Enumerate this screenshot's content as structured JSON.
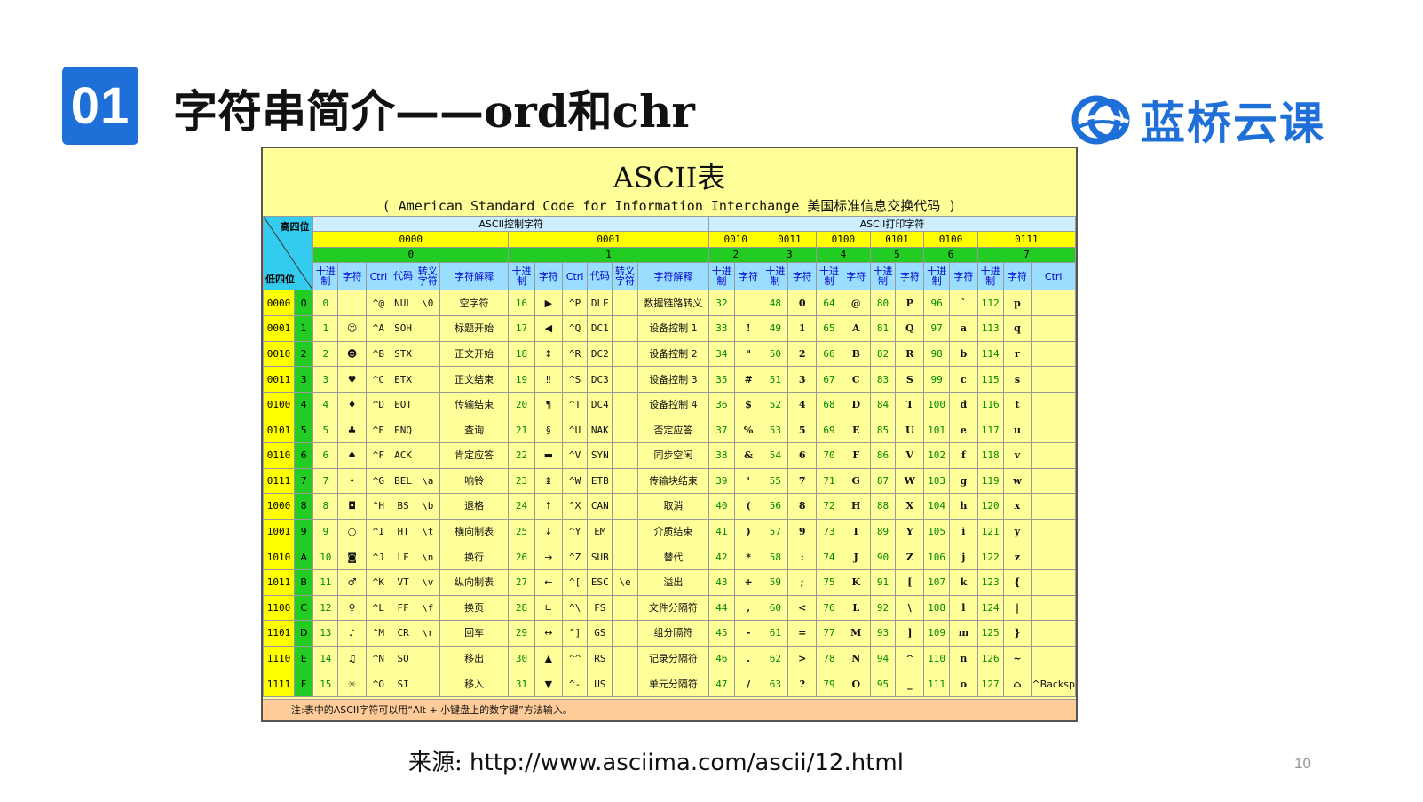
{
  "slide": {
    "number": "01",
    "title": "字符串简介——ord和chr",
    "logo_text": "蓝桥云课",
    "source_label": "来源:",
    "source_url": "http://www.asciima.com/ascii/12.html",
    "page_number": "10",
    "accent_color": "#1f6fd8"
  },
  "ascii": {
    "title": "ASCII表",
    "subtitle": "( American Standard Code for Information Interchange  美国标准信息交换代码 )",
    "corner_high": "高四位",
    "corner_low": "低四位",
    "group_control": "ASCII控制字符",
    "group_print": "ASCII打印字符",
    "high_bits": [
      "0000",
      "0001",
      "0010",
      "0011",
      "0100",
      "0101",
      "0100",
      "0111"
    ],
    "high_hex": [
      "0",
      "1",
      "2",
      "3",
      "4",
      "5",
      "6",
      "7"
    ],
    "col_dec": "十进制",
    "col_char": "字符",
    "col_ctrl": "Ctrl",
    "col_code": "代码",
    "col_esc": "转义字符",
    "col_desc": "字符解释",
    "note": "注:表中的ASCII字符可以用“Alt + 小键盘上的数字键”方法输入。",
    "del_note": "^Backspace 代码:DEL",
    "rows": [
      {
        "bin": "0000",
        "hex": "0",
        "c0": [
          "0",
          "",
          "^@",
          "NUL",
          "\\0",
          "空字符"
        ],
        "c1": [
          "16",
          "▶",
          "^P",
          "DLE",
          "",
          "数据链路转义"
        ],
        "p": [
          [
            "32",
            ""
          ],
          [
            "48",
            "0"
          ],
          [
            "64",
            "@"
          ],
          [
            "80",
            "P"
          ],
          [
            "96",
            "`"
          ],
          [
            "112",
            "p"
          ]
        ]
      },
      {
        "bin": "0001",
        "hex": "1",
        "c0": [
          "1",
          "☺",
          "^A",
          "SOH",
          "",
          "标题开始"
        ],
        "c1": [
          "17",
          "◀",
          "^Q",
          "DC1",
          "",
          "设备控制 1"
        ],
        "p": [
          [
            "33",
            "!"
          ],
          [
            "49",
            "1"
          ],
          [
            "65",
            "A"
          ],
          [
            "81",
            "Q"
          ],
          [
            "97",
            "a"
          ],
          [
            "113",
            "q"
          ]
        ]
      },
      {
        "bin": "0010",
        "hex": "2",
        "c0": [
          "2",
          "☻",
          "^B",
          "STX",
          "",
          "正文开始"
        ],
        "c1": [
          "18",
          "↕",
          "^R",
          "DC2",
          "",
          "设备控制 2"
        ],
        "p": [
          [
            "34",
            "\""
          ],
          [
            "50",
            "2"
          ],
          [
            "66",
            "B"
          ],
          [
            "82",
            "R"
          ],
          [
            "98",
            "b"
          ],
          [
            "114",
            "r"
          ]
        ]
      },
      {
        "bin": "0011",
        "hex": "3",
        "c0": [
          "3",
          "♥",
          "^C",
          "ETX",
          "",
          "正文结束"
        ],
        "c1": [
          "19",
          "‼",
          "^S",
          "DC3",
          "",
          "设备控制 3"
        ],
        "p": [
          [
            "35",
            "#"
          ],
          [
            "51",
            "3"
          ],
          [
            "67",
            "C"
          ],
          [
            "83",
            "S"
          ],
          [
            "99",
            "c"
          ],
          [
            "115",
            "s"
          ]
        ]
      },
      {
        "bin": "0100",
        "hex": "4",
        "c0": [
          "4",
          "♦",
          "^D",
          "EOT",
          "",
          "传输结束"
        ],
        "c1": [
          "20",
          "¶",
          "^T",
          "DC4",
          "",
          "设备控制 4"
        ],
        "p": [
          [
            "36",
            "$"
          ],
          [
            "52",
            "4"
          ],
          [
            "68",
            "D"
          ],
          [
            "84",
            "T"
          ],
          [
            "100",
            "d"
          ],
          [
            "116",
            "t"
          ]
        ]
      },
      {
        "bin": "0101",
        "hex": "5",
        "c0": [
          "5",
          "♣",
          "^E",
          "ENQ",
          "",
          "查询"
        ],
        "c1": [
          "21",
          "§",
          "^U",
          "NAK",
          "",
          "否定应答"
        ],
        "p": [
          [
            "37",
            "%"
          ],
          [
            "53",
            "5"
          ],
          [
            "69",
            "E"
          ],
          [
            "85",
            "U"
          ],
          [
            "101",
            "e"
          ],
          [
            "117",
            "u"
          ]
        ]
      },
      {
        "bin": "0110",
        "hex": "6",
        "c0": [
          "6",
          "♠",
          "^F",
          "ACK",
          "",
          "肯定应答"
        ],
        "c1": [
          "22",
          "▬",
          "^V",
          "SYN",
          "",
          "同步空闲"
        ],
        "p": [
          [
            "38",
            "&"
          ],
          [
            "54",
            "6"
          ],
          [
            "70",
            "F"
          ],
          [
            "86",
            "V"
          ],
          [
            "102",
            "f"
          ],
          [
            "118",
            "v"
          ]
        ]
      },
      {
        "bin": "0111",
        "hex": "7",
        "c0": [
          "7",
          "•",
          "^G",
          "BEL",
          "\\a",
          "响铃"
        ],
        "c1": [
          "23",
          "↨",
          "^W",
          "ETB",
          "",
          "传输块结束"
        ],
        "p": [
          [
            "39",
            "'"
          ],
          [
            "55",
            "7"
          ],
          [
            "71",
            "G"
          ],
          [
            "87",
            "W"
          ],
          [
            "103",
            "g"
          ],
          [
            "119",
            "w"
          ]
        ]
      },
      {
        "bin": "1000",
        "hex": "8",
        "c0": [
          "8",
          "◘",
          "^H",
          "BS",
          "\\b",
          "退格"
        ],
        "c1": [
          "24",
          "↑",
          "^X",
          "CAN",
          "",
          "取消"
        ],
        "p": [
          [
            "40",
            "("
          ],
          [
            "56",
            "8"
          ],
          [
            "72",
            "H"
          ],
          [
            "88",
            "X"
          ],
          [
            "104",
            "h"
          ],
          [
            "120",
            "x"
          ]
        ]
      },
      {
        "bin": "1001",
        "hex": "9",
        "c0": [
          "9",
          "○",
          "^I",
          "HT",
          "\\t",
          "横向制表"
        ],
        "c1": [
          "25",
          "↓",
          "^Y",
          "EM",
          "",
          "介质结束"
        ],
        "p": [
          [
            "41",
            ")"
          ],
          [
            "57",
            "9"
          ],
          [
            "73",
            "I"
          ],
          [
            "89",
            "Y"
          ],
          [
            "105",
            "i"
          ],
          [
            "121",
            "y"
          ]
        ]
      },
      {
        "bin": "1010",
        "hex": "A",
        "c0": [
          "10",
          "◙",
          "^J",
          "LF",
          "\\n",
          "换行"
        ],
        "c1": [
          "26",
          "→",
          "^Z",
          "SUB",
          "",
          "替代"
        ],
        "p": [
          [
            "42",
            "*"
          ],
          [
            "58",
            ":"
          ],
          [
            "74",
            "J"
          ],
          [
            "90",
            "Z"
          ],
          [
            "106",
            "j"
          ],
          [
            "122",
            "z"
          ]
        ]
      },
      {
        "bin": "1011",
        "hex": "B",
        "c0": [
          "11",
          "♂",
          "^K",
          "VT",
          "\\v",
          "纵向制表"
        ],
        "c1": [
          "27",
          "←",
          "^[",
          "ESC",
          "\\e",
          "溢出"
        ],
        "p": [
          [
            "43",
            "+"
          ],
          [
            "59",
            ";"
          ],
          [
            "75",
            "K"
          ],
          [
            "91",
            "["
          ],
          [
            "107",
            "k"
          ],
          [
            "123",
            "{"
          ]
        ]
      },
      {
        "bin": "1100",
        "hex": "C",
        "c0": [
          "12",
          "♀",
          "^L",
          "FF",
          "\\f",
          "换页"
        ],
        "c1": [
          "28",
          "∟",
          "^\\",
          "FS",
          "",
          "文件分隔符"
        ],
        "p": [
          [
            "44",
            ","
          ],
          [
            "60",
            "<"
          ],
          [
            "76",
            "L"
          ],
          [
            "92",
            "\\"
          ],
          [
            "108",
            "l"
          ],
          [
            "124",
            "|"
          ]
        ]
      },
      {
        "bin": "1101",
        "hex": "D",
        "c0": [
          "13",
          "♪",
          "^M",
          "CR",
          "\\r",
          "回车"
        ],
        "c1": [
          "29",
          "↔",
          "^]",
          "GS",
          "",
          "组分隔符"
        ],
        "p": [
          [
            "45",
            "-"
          ],
          [
            "61",
            "="
          ],
          [
            "77",
            "M"
          ],
          [
            "93",
            "]"
          ],
          [
            "109",
            "m"
          ],
          [
            "125",
            "}"
          ]
        ]
      },
      {
        "bin": "1110",
        "hex": "E",
        "c0": [
          "14",
          "♫",
          "^N",
          "SO",
          "",
          "移出"
        ],
        "c1": [
          "30",
          "▲",
          "^^",
          "RS",
          "",
          "记录分隔符"
        ],
        "p": [
          [
            "46",
            "."
          ],
          [
            "62",
            ">"
          ],
          [
            "78",
            "N"
          ],
          [
            "94",
            "^"
          ],
          [
            "110",
            "n"
          ],
          [
            "126",
            "~"
          ]
        ]
      },
      {
        "bin": "1111",
        "hex": "F",
        "c0": [
          "15",
          "☼",
          "^O",
          "SI",
          "",
          "移入"
        ],
        "c1": [
          "31",
          "▼",
          "^-",
          "US",
          "",
          "单元分隔符"
        ],
        "p": [
          [
            "47",
            "/"
          ],
          [
            "63",
            "?"
          ],
          [
            "79",
            "O"
          ],
          [
            "95",
            "_"
          ],
          [
            "111",
            "o"
          ],
          [
            "127",
            "⌂"
          ]
        ]
      }
    ]
  }
}
